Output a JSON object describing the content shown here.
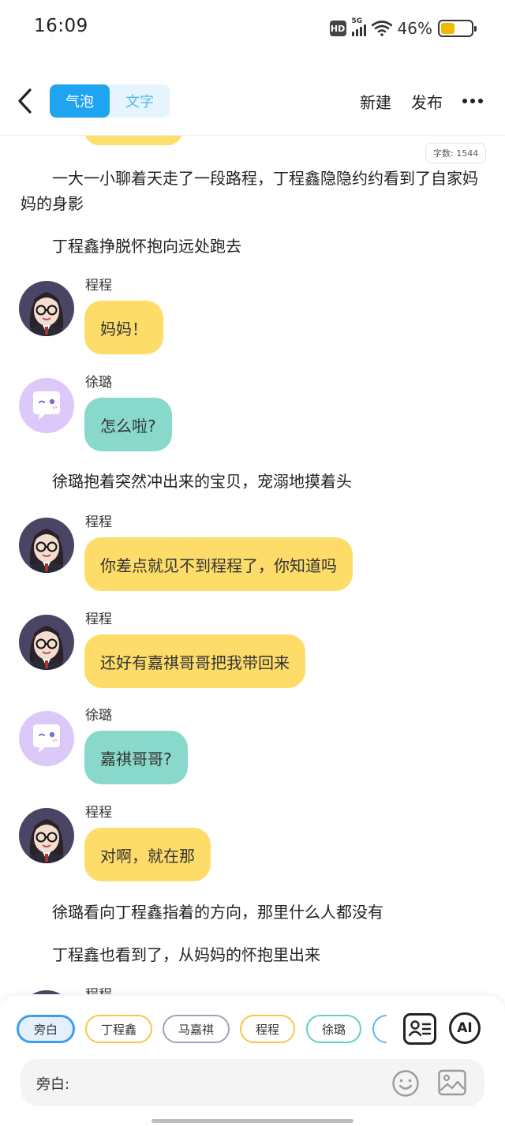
{
  "status_bar": {
    "time": "16:09",
    "hd": "HD",
    "network": "5G",
    "battery_text": "46%",
    "battery_level": 0.46
  },
  "nav": {
    "tabs": [
      "气泡",
      "文字"
    ],
    "active_tab": 0,
    "new_label": "新建",
    "publish_label": "发布"
  },
  "editor": {
    "word_count": "字数: 1544"
  },
  "story": [
    {
      "type": "narration",
      "text": "一大一小聊着天走了一段路程，丁程鑫隐隐约约看到了自家妈妈的身影"
    },
    {
      "type": "narration",
      "text": "丁程鑫挣脱怀抱向远处跑去"
    },
    {
      "type": "message",
      "speaker": "程程",
      "text": "妈妈！"
    },
    {
      "type": "message",
      "speaker": "徐璐",
      "text": "怎么啦?"
    },
    {
      "type": "narration",
      "text": "徐璐抱着突然冲出来的宝贝，宠溺地摸着头"
    },
    {
      "type": "message",
      "speaker": "程程",
      "text": "你差点就见不到程程了，你知道吗"
    },
    {
      "type": "message",
      "speaker": "程程",
      "text": "还好有嘉祺哥哥把我带回来"
    },
    {
      "type": "message",
      "speaker": "徐璐",
      "text": "嘉祺哥哥?"
    },
    {
      "type": "message",
      "speaker": "程程",
      "text": "对啊，就在那"
    },
    {
      "type": "narration",
      "text": "徐璐看向丁程鑫指着的方向，那里什么人都没有"
    },
    {
      "type": "narration",
      "text": "丁程鑫也看到了，从妈妈的怀抱里出来"
    },
    {
      "type": "message",
      "speaker": "程程",
      "text": ""
    }
  ],
  "roles": [
    "旁白",
    "丁程鑫",
    "马嘉祺",
    "程程",
    "徐璐"
  ],
  "input": {
    "label": "旁白:",
    "ai_label": "AI"
  },
  "colors": {
    "accent": "#1ea4f0",
    "bubble_yellow": "#fedc69",
    "bubble_teal": "#88d9cb"
  }
}
